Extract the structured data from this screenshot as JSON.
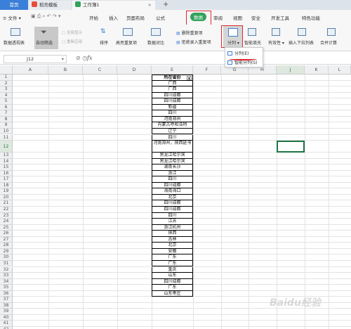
{
  "tabs": {
    "home": "首页",
    "template": "稻壳模板",
    "workbook": "工作簿1",
    "add": "+"
  },
  "menu": {
    "file": "文件",
    "items": [
      "开始",
      "插入",
      "页面布局",
      "公式",
      "数据",
      "审阅",
      "视图",
      "安全",
      "开发工具",
      "特色功能"
    ]
  },
  "ribbon": {
    "pivot": "数据透视表",
    "autofilter": "自动筛选",
    "show_all": "全部显示",
    "reapply": "重新应用",
    "sort": "排序",
    "highlight_dup": "高亮重复项",
    "compare": "数据对比",
    "remove_dup": "删除重复项",
    "reject_dup": "拒绝录入重复项",
    "split": "分列",
    "smart_fill": "智能填充",
    "validity": "有效性",
    "dropdown_list": "插入下拉列表",
    "merge_calc": "合并计算"
  },
  "split_menu": {
    "item1": "分列(E)",
    "item2": "智能分列(S)"
  },
  "formula_bar": {
    "cell_ref": "J12",
    "fx": "fx",
    "icons": "⊘ ◷"
  },
  "columns": [
    "A",
    "B",
    "C",
    "D",
    "E",
    "F",
    "G",
    "H",
    "I",
    "J",
    "K",
    "L"
  ],
  "rows": [
    "1",
    "2",
    "3",
    "4",
    "5",
    "6",
    "7",
    "8",
    "9",
    "10",
    "11",
    "12",
    "13",
    "14",
    "15",
    "16",
    "17",
    "18",
    "19",
    "20",
    "21",
    "22",
    "23",
    "24",
    "25",
    "26",
    "27",
    "28",
    "29",
    "30",
    "31",
    "32",
    "33",
    "34",
    "35",
    "36",
    "37",
    "38",
    "39",
    "40",
    "41",
    "42"
  ],
  "table": {
    "header": "所在省份",
    "filter_icon": "▼",
    "values": [
      "广西",
      "广西",
      "四川成都",
      "四川成都",
      "新疆",
      "四川",
      "河南郑州",
      "内蒙古呼和浩特",
      "辽宁",
      "四川",
      "河南郑州，陕西延书",
      "黑龙江哈尔滨",
      "黑龙江哈尔滨",
      "湖南长沙",
      "浙江",
      "四川",
      "四川成都",
      "海南海口",
      "北京",
      "四川成都",
      "四川成都",
      "四川",
      "江苏",
      "浙江杭州",
      "陕西",
      "吉林",
      "北京",
      "安徽",
      "广东",
      "广东",
      "重庆",
      "山东",
      "四川成都",
      "广东",
      "山东枣庄"
    ]
  },
  "watermark": "Baidu经验"
}
